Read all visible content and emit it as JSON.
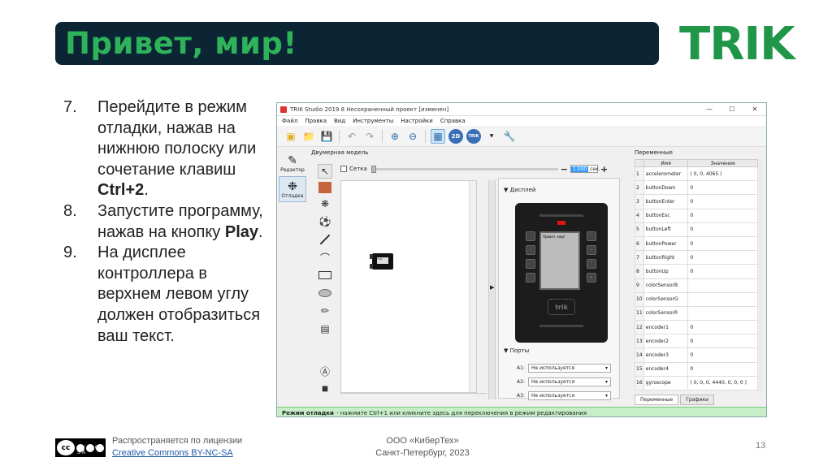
{
  "slide": {
    "title": "Привет, мир!",
    "logo_text": "TRIK",
    "steps": [
      {
        "num": "7.",
        "text_before": "Перейдите в режим отладки, нажав на нижнюю полоску или сочетание клавиш ",
        "bold": "Ctrl+2",
        "text_after": "."
      },
      {
        "num": "8.",
        "text_before": "Запустите программу, нажав на кнопку ",
        "bold": "Play",
        "text_after": "."
      },
      {
        "num": "9.",
        "text_before": "На дисплее контроллера в верхнем левом углу должен отобразиться ваш текст.",
        "bold": "",
        "text_after": ""
      }
    ],
    "footer": {
      "license_line": "Распространяется по лицензии",
      "license_link": "Creative Commons BY-NC-SA",
      "cc_labels": "BY NC SA",
      "org_line1": "ООО «КиберТех»",
      "org_line2": "Санкт-Петербург, 2023",
      "page_number": "13"
    }
  },
  "window": {
    "title": "TRIK Studio 2019.8 Несохраненный проект [изменен]",
    "menu": [
      "Файл",
      "Правка",
      "Вид",
      "Инструменты",
      "Настройки",
      "Справка"
    ],
    "toolbar_2d": "2D",
    "toolbar_trik": "TRIK",
    "modes": [
      {
        "label": "Редактор",
        "icon": "edit-icon"
      },
      {
        "label": "Отладка",
        "icon": "bug-icon"
      }
    ],
    "model_label": "Двумерная модель",
    "grid_label": "Сетка",
    "speed_value": "1.000",
    "speed_unit": "сек.",
    "display_header": "Дисплей",
    "ports_header": "Порты",
    "lcd_text": "Привет, мир!",
    "device_logo": "trik",
    "ports": [
      {
        "name": "A1:",
        "value": "Не используется"
      },
      {
        "name": "A2:",
        "value": "Не используется"
      },
      {
        "name": "A3:",
        "value": "Не используется"
      }
    ],
    "vars_header": "Переменные",
    "vars_columns": [
      "Имя",
      "Значение"
    ],
    "vars": [
      {
        "idx": "1",
        "name": "accelerometer",
        "value": "( 0, 0, 4065 )"
      },
      {
        "idx": "2",
        "name": "buttonDown",
        "value": "0"
      },
      {
        "idx": "3",
        "name": "buttonEnter",
        "value": "0"
      },
      {
        "idx": "4",
        "name": "buttonEsc",
        "value": "0"
      },
      {
        "idx": "5",
        "name": "buttonLeft",
        "value": "0"
      },
      {
        "idx": "6",
        "name": "buttonPower",
        "value": "0"
      },
      {
        "idx": "7",
        "name": "buttonRight",
        "value": "0"
      },
      {
        "idx": "8",
        "name": "buttonUp",
        "value": "0"
      },
      {
        "idx": "9",
        "name": "colorSensorB",
        "value": ""
      },
      {
        "idx": "10",
        "name": "colorSensorG",
        "value": ""
      },
      {
        "idx": "11",
        "name": "colorSensorR",
        "value": ""
      },
      {
        "idx": "12",
        "name": "encoder1",
        "value": "0"
      },
      {
        "idx": "13",
        "name": "encoder2",
        "value": "0"
      },
      {
        "idx": "14",
        "name": "encoder3",
        "value": "0"
      },
      {
        "idx": "15",
        "name": "encoder4",
        "value": "0"
      },
      {
        "idx": "16",
        "name": "gyroscope",
        "value": "( 0, 0, 0, 4440, 0, 0, 0 )"
      }
    ],
    "vars_tabs": [
      "Переменные",
      "Графики"
    ],
    "status_bold": "Режим отладки",
    "status_text": "- нажмите Ctrl+1 или кликните здесь для переключения в режим редактирования"
  },
  "colors": {
    "title_bg": "#0b2534",
    "title_fg": "#2eb35a",
    "logo": "#1f9648",
    "status_bg": "#c7eec7"
  }
}
